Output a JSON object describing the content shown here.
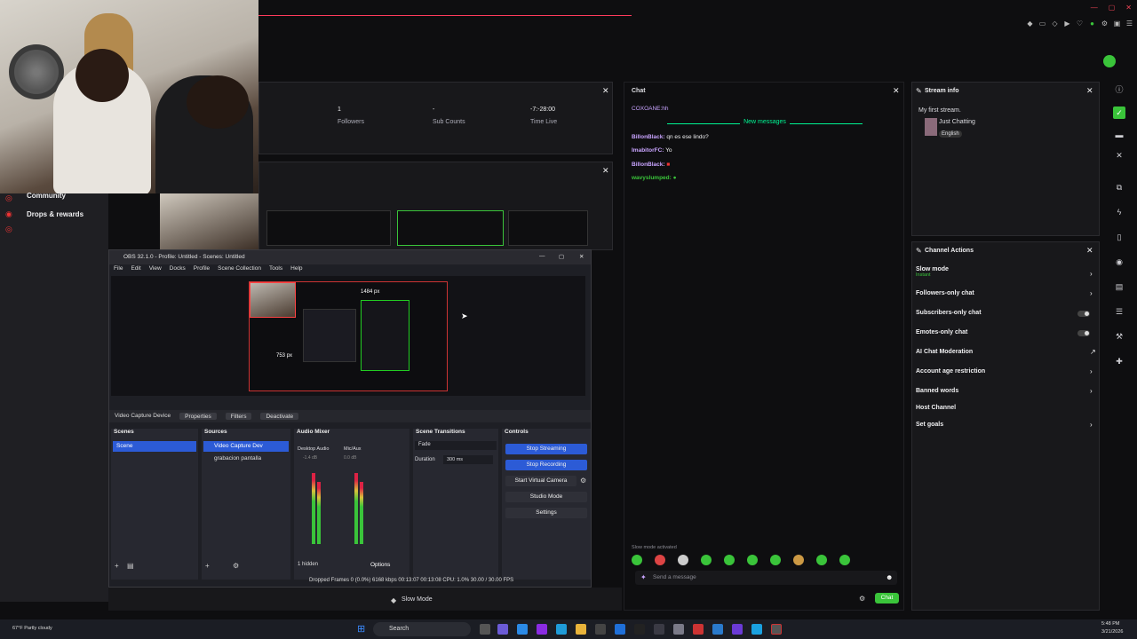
{
  "sidebar": {
    "items": [
      {
        "label": "Community"
      },
      {
        "label": "Drops & rewards"
      }
    ]
  },
  "stats": {
    "followers_value": "1",
    "followers_label": "Followers",
    "subs_value": "-",
    "subs_label": "Sub Counts",
    "time_value": "-7:-28:00",
    "time_label": "Time Live"
  },
  "chat": {
    "title": "Chat",
    "pinned_user": "COXOANE:hh",
    "new_messages": "New messages",
    "messages": [
      {
        "user": "BillonBlack:",
        "text": "qn es ese lindo?",
        "color": "#c9a4ff"
      },
      {
        "user": "ImabitorFC:",
        "text": "Yo",
        "color": "#c9a4ff"
      },
      {
        "user": "BillonBlack:",
        "text": "",
        "color": "#c9a4ff"
      },
      {
        "user": "wavyslumped:",
        "text": "",
        "color": "#3ac43a"
      }
    ],
    "slow_mode_notice": "Slow mode activated",
    "input_placeholder": "Send a message",
    "chat_button": "Chat"
  },
  "stream_info": {
    "title": "Stream info",
    "stream_title": "My first stream.",
    "category": "Just Chatting",
    "language": "English"
  },
  "channel_actions": {
    "title": "Channel Actions",
    "items": [
      {
        "label": "Slow mode",
        "sub": "Instant"
      },
      {
        "label": "Followers-only chat"
      },
      {
        "label": "Subscribers-only chat"
      },
      {
        "label": "Emotes-only chat"
      },
      {
        "label": "AI Chat Moderation"
      },
      {
        "label": "Account age restriction"
      },
      {
        "label": "Banned words"
      },
      {
        "label": "Host Channel"
      },
      {
        "label": "Set goals"
      }
    ]
  },
  "obs": {
    "title": "OBS 32.1.0 - Profile: Untitled - Scenes: Untitled",
    "menu": [
      "File",
      "Edit",
      "View",
      "Docks",
      "Profile",
      "Scene Collection",
      "Tools",
      "Help"
    ],
    "preview_width_label": "1484 px",
    "preview_height_label": "753 px",
    "source_name": "Video Capture Device",
    "properties": "Properties",
    "filters": "Filters",
    "deactivate": "Deactivate",
    "docks": {
      "scenes": "Scenes",
      "sources": "Sources",
      "audio_mixer": "Audio Mixer",
      "scene_transitions": "Scene Transitions",
      "controls": "Controls"
    },
    "scene_item": "Scene",
    "source_items": [
      "Video Capture Dev",
      "grabacion pantalla"
    ],
    "mixer": {
      "ch1": "Desktop Audio",
      "ch2": "Mic/Aux",
      "ch1_db": "-1.4 dB",
      "ch2_db": "0.0 dB",
      "hidden": "1 hidden",
      "options": "Options"
    },
    "transition": {
      "value": "Fade",
      "duration_label": "Duration",
      "duration_value": "300 ms"
    },
    "controls": {
      "stop_streaming": "Stop Streaming",
      "stop_recording": "Stop Recording",
      "virtual_camera": "Start Virtual Camera",
      "studio_mode": "Studio Mode",
      "settings": "Settings"
    },
    "status": "Dropped Frames 0 (0.0%)   6168 kbps   00:13:07   00:13:08   CPU: 1.0%   30.00 / 30.00 FPS"
  },
  "bottom": {
    "slow_mode": "Slow Mode"
  },
  "taskbar": {
    "weather": "67°F Partly cloudy",
    "search": "Search",
    "time": "5:48 PM",
    "date": "3/21/2026"
  }
}
